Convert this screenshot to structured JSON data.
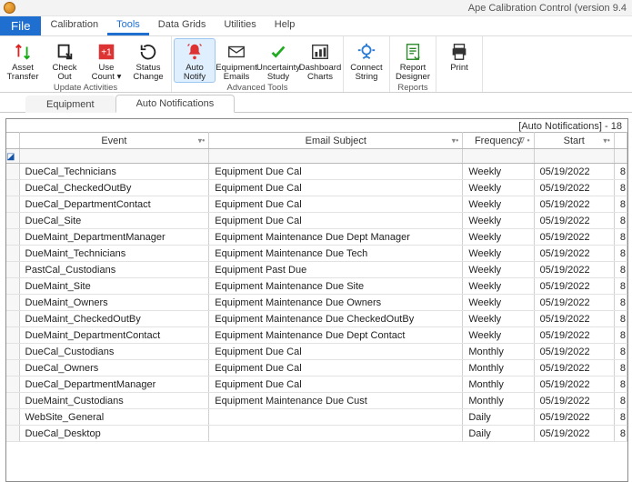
{
  "app": {
    "title": "Ape Calibration Control (version 9.4"
  },
  "menu": {
    "file": "File",
    "items": [
      "Calibration",
      "Tools",
      "Data Grids",
      "Utilities",
      "Help"
    ],
    "active_index": 1
  },
  "ribbon": {
    "groups": [
      {
        "label": "Update Activities",
        "buttons": [
          {
            "key": "asset-transfer",
            "line1": "Asset",
            "line2": "Transfer",
            "icon": "transfer"
          },
          {
            "key": "check-out",
            "line1": "Check",
            "line2": "Out",
            "icon": "checkout"
          },
          {
            "key": "use-count",
            "line1": "Use",
            "line2": "Count ▾",
            "icon": "plusone"
          },
          {
            "key": "status-change",
            "line1": "Status",
            "line2": "Change",
            "icon": "status"
          }
        ]
      },
      {
        "label": "Advanced Tools",
        "buttons": [
          {
            "key": "auto-notify",
            "line1": "Auto",
            "line2": "Notify",
            "icon": "bell",
            "selected": true
          },
          {
            "key": "equipment-emails",
            "line1": "Equipment",
            "line2": "Emails",
            "icon": "envelope"
          },
          {
            "key": "uncertainty-study",
            "line1": "Uncertainty",
            "line2": "Study",
            "icon": "check"
          },
          {
            "key": "dashboard-charts",
            "line1": "Dashboard",
            "line2": "Charts",
            "icon": "chart"
          }
        ]
      },
      {
        "label": "",
        "buttons": [
          {
            "key": "connect-string",
            "line1": "Connect",
            "line2": "String",
            "icon": "connect"
          }
        ]
      },
      {
        "label": "Reports",
        "buttons": [
          {
            "key": "report-designer",
            "line1": "Report",
            "line2": "Designer",
            "icon": "report"
          }
        ]
      },
      {
        "label": "",
        "buttons": [
          {
            "key": "print",
            "line1": "Print",
            "line2": "",
            "icon": "print"
          }
        ]
      }
    ]
  },
  "sub_tabs": {
    "items": [
      "Equipment",
      "Auto Notifications"
    ],
    "active_index": 1
  },
  "grid": {
    "title": "[Auto Notifications] - 18",
    "columns": [
      "Event",
      "Email Subject",
      "Frequency",
      "Start"
    ],
    "rows": [
      {
        "event": "DueCal_Technicians",
        "subject": "Equipment Due Cal",
        "freq": "Weekly",
        "start": "05/19/2022"
      },
      {
        "event": "DueCal_CheckedOutBy",
        "subject": "Equipment Due Cal",
        "freq": "Weekly",
        "start": "05/19/2022"
      },
      {
        "event": "DueCal_DepartmentContact",
        "subject": "Equipment Due Cal",
        "freq": "Weekly",
        "start": "05/19/2022"
      },
      {
        "event": "DueCal_Site",
        "subject": "Equipment Due Cal",
        "freq": "Weekly",
        "start": "05/19/2022"
      },
      {
        "event": "DueMaint_DepartmentManager",
        "subject": "Equipment Maintenance Due Dept Manager",
        "freq": "Weekly",
        "start": "05/19/2022"
      },
      {
        "event": "DueMaint_Technicians",
        "subject": "Equipment Maintenance Due Tech",
        "freq": "Weekly",
        "start": "05/19/2022"
      },
      {
        "event": "PastCal_Custodians",
        "subject": "Equipment Past Due",
        "freq": "Weekly",
        "start": "05/19/2022"
      },
      {
        "event": "DueMaint_Site",
        "subject": "Equipment Maintenance Due Site",
        "freq": "Weekly",
        "start": "05/19/2022"
      },
      {
        "event": "DueMaint_Owners",
        "subject": "Equipment Maintenance Due Owners",
        "freq": "Weekly",
        "start": "05/19/2022"
      },
      {
        "event": "DueMaint_CheckedOutBy",
        "subject": "Equipment Maintenance Due CheckedOutBy",
        "freq": "Weekly",
        "start": "05/19/2022"
      },
      {
        "event": "DueMaint_DepartmentContact",
        "subject": "Equipment Maintenance Due Dept Contact",
        "freq": "Weekly",
        "start": "05/19/2022"
      },
      {
        "event": "DueCal_Custodians",
        "subject": "Equipment Due Cal",
        "freq": "Monthly",
        "start": "05/19/2022"
      },
      {
        "event": "DueCal_Owners",
        "subject": "Equipment Due Cal",
        "freq": "Monthly",
        "start": "05/19/2022"
      },
      {
        "event": "DueCal_DepartmentManager",
        "subject": "Equipment Due Cal",
        "freq": "Monthly",
        "start": "05/19/2022"
      },
      {
        "event": "DueMaint_Custodians",
        "subject": "Equipment Maintenance Due Cust",
        "freq": "Monthly",
        "start": "05/19/2022"
      },
      {
        "event": "WebSite_General",
        "subject": "",
        "freq": "Daily",
        "start": "05/19/2022"
      },
      {
        "event": "DueCal_Desktop",
        "subject": "",
        "freq": "Daily",
        "start": "05/19/2022"
      }
    ]
  }
}
